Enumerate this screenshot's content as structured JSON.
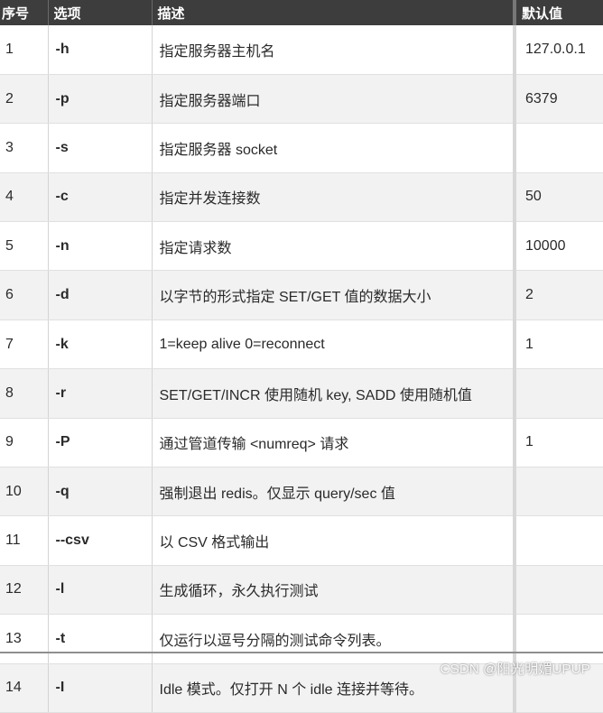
{
  "table": {
    "headers": {
      "no": "序号",
      "option": "选项",
      "description": "描述",
      "default": "默认值"
    },
    "rows": [
      {
        "no": "1",
        "option": "-h",
        "description": "指定服务器主机名",
        "default": "127.0.0.1"
      },
      {
        "no": "2",
        "option": "-p",
        "description": "指定服务器端口",
        "default": "6379"
      },
      {
        "no": "3",
        "option": "-s",
        "description": "指定服务器 socket",
        "default": ""
      },
      {
        "no": "4",
        "option": "-c",
        "description": "指定并发连接数",
        "default": "50"
      },
      {
        "no": "5",
        "option": "-n",
        "description": "指定请求数",
        "default": "10000"
      },
      {
        "no": "6",
        "option": "-d",
        "description": "以字节的形式指定 SET/GET 值的数据大小",
        "default": "2"
      },
      {
        "no": "7",
        "option": "-k",
        "description": "1=keep alive 0=reconnect",
        "default": "1"
      },
      {
        "no": "8",
        "option": "-r",
        "description": "SET/GET/INCR 使用随机 key, SADD 使用随机值",
        "default": ""
      },
      {
        "no": "9",
        "option": "-P",
        "description": "通过管道传输 <numreq> 请求",
        "default": "1"
      },
      {
        "no": "10",
        "option": "-q",
        "description": "强制退出 redis。仅显示 query/sec 值",
        "default": ""
      },
      {
        "no": "11",
        "option": "--csv",
        "description": "以 CSV 格式输出",
        "default": ""
      },
      {
        "no": "12",
        "option": "-l",
        "description": "生成循环，永久执行测试",
        "default": ""
      },
      {
        "no": "13",
        "option": "-t",
        "description": "仅运行以逗号分隔的测试命令列表。",
        "default": ""
      },
      {
        "no": "14",
        "option": "-I",
        "description": "Idle 模式。仅打开 N 个 idle 连接并等待。",
        "default": ""
      }
    ]
  },
  "watermark": "CSDN @阳光明媚UPUP"
}
